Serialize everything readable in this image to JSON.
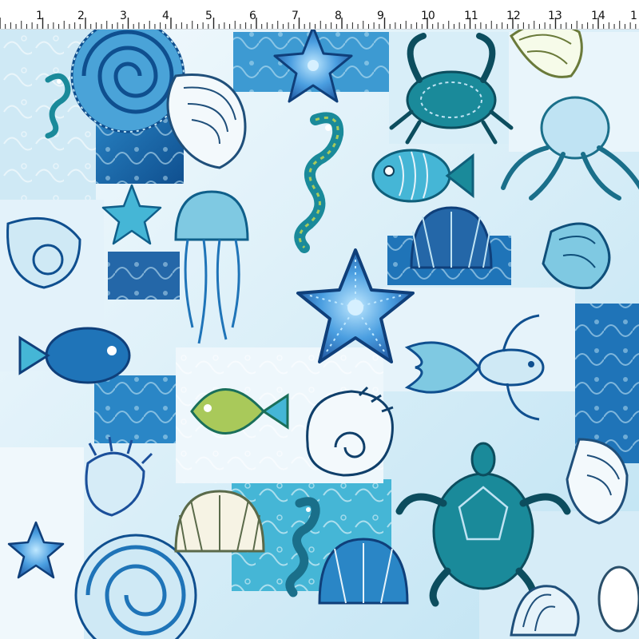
{
  "ruler": {
    "unit_labels": [
      "1",
      "2",
      "3",
      "4",
      "5",
      "6",
      "7",
      "8",
      "9",
      "10",
      "11",
      "12",
      "13",
      "14",
      "1"
    ]
  },
  "palette": {
    "deep_blue": "#0f4f8f",
    "ocean": "#1f74b8",
    "teal": "#1a8a9a",
    "aqua": "#45b6d6",
    "sky": "#bfe3f3",
    "ice": "#e6f3fa",
    "lime": "#a9c95a"
  },
  "motifs": [
    "starfish-icon",
    "seahorse-icon",
    "jellyfish-icon",
    "fish-icon",
    "crab-icon",
    "octopus-icon",
    "sea-turtle-icon",
    "seashell-icon",
    "scallop-icon",
    "conch-icon",
    "ammonite-icon"
  ]
}
